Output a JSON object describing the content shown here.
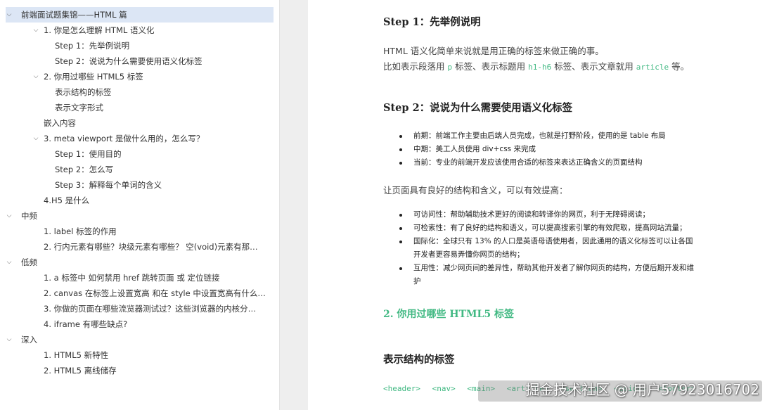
{
  "outline": [
    {
      "level": 0,
      "chevron": "down",
      "label": "前端面试题集锦——HTML 篇",
      "active": true
    },
    {
      "level": 1,
      "chevron": "down",
      "label": "1. 你是怎么理解 HTML 语义化"
    },
    {
      "level": 2,
      "chevron": "",
      "label": "Step 1：先举例说明"
    },
    {
      "level": 2,
      "chevron": "",
      "label": "Step 2：说说为什么需要使用语义化标签"
    },
    {
      "level": 1,
      "chevron": "down",
      "label": "2. 你用过哪些 HTML5 标签"
    },
    {
      "level": 2,
      "chevron": "",
      "label": "表示结构的标签"
    },
    {
      "level": 2,
      "chevron": "",
      "label": "表示文字形式"
    },
    {
      "level": 1,
      "chevron": "",
      "label": "嵌入内容"
    },
    {
      "level": 1,
      "chevron": "down",
      "label": "3. meta viewport  是做什么用的，怎么写？"
    },
    {
      "level": 2,
      "chevron": "",
      "label": "Step 1：使用目的"
    },
    {
      "level": 2,
      "chevron": "",
      "label": "Step 2：怎么写"
    },
    {
      "level": 2,
      "chevron": "",
      "label": "Step 3：解释每个单词的含义"
    },
    {
      "level": 1,
      "chevron": "",
      "label": "4.H5 是什么"
    },
    {
      "level": 0,
      "chevron": "down",
      "label": "中频"
    },
    {
      "level": 1,
      "chevron": "",
      "label": "1. label 标签的作用"
    },
    {
      "level": 1,
      "chevron": "",
      "label": "2. 行内元素有哪些？块级元素有哪些？  空(void)元素有那…"
    },
    {
      "level": 0,
      "chevron": "down",
      "label": "低频"
    },
    {
      "level": 1,
      "chevron": "",
      "label": "1. a 标签中  如何禁用 href  跳转页面  或  定位链接"
    },
    {
      "level": 1,
      "chevron": "",
      "label": "2. canvas 在标签上设置宽高  和在 style 中设置宽高有什么…"
    },
    {
      "level": 1,
      "chevron": "",
      "label": "3. 你做的页面在哪些流览器测试过？这些浏览器的内核分…"
    },
    {
      "level": 1,
      "chevron": "",
      "label": "4. iframe 有哪些缺点?"
    },
    {
      "level": 0,
      "chevron": "down",
      "label": "深入"
    },
    {
      "level": 1,
      "chevron": "",
      "label": "1. HTML5 新特性"
    },
    {
      "level": 1,
      "chevron": "",
      "label": "2. HTML5 离线储存"
    }
  ],
  "doc": {
    "step1_title": "Step 1：先举例说明",
    "step1_p1": "HTML 语义化简单来说就是用正确的标签来做正确的事。",
    "step1_p2_a": "比如表示段落用",
    "step1_p2_code1": "p",
    "step1_p2_b": "标签、表示标题用",
    "step1_p2_code2": "h1-h6",
    "step1_p2_c": "标签、表示文章就用",
    "step1_p2_code3": "article",
    "step1_p2_d": "等。",
    "step2_title": "Step 2：说说为什么需要使用语义化标签",
    "list1": [
      "前期：前端工作主要由后端人员完成，也就是打野阶段，使用的是 table 布局",
      "中期：美工人员使用 div+css 来完成",
      "当前：专业的前端开发应该使用合适的标签来表达正确含义的页面结构"
    ],
    "para_improve": "让页面具有良好的结构和含义，可以有效提高：",
    "list2": [
      "可访问性：帮助辅助技术更好的阅读和转译你的网页，利于无障碍阅读；",
      "可检索性：有了良好的结构和语义，可以提高搜索引擎的有效爬取，提高网站流量；",
      "国际化：全球只有 13% 的人口是英语母语使用者，因此通用的语义化标签可以让各国开发者更容易弄懂你网页的结构；",
      "互用性：减少网页间的差异性，帮助其他开发者了解你网页的结构，方便后期开发和维护"
    ],
    "h2_title": "2. 你用过哪些 HTML5 标签",
    "h3_title": "表示结构的标签",
    "code_tags": [
      "<header>",
      "<nav>",
      "<main>",
      "<article>",
      "<section>",
      "<aside>",
      "<footer>"
    ]
  },
  "watermark": "掘金技术社区 @ 用户57923016702",
  "colors": {
    "accent_green": "#42b983",
    "active_row": "#dce6f5",
    "gutter": "#eeeeee"
  }
}
